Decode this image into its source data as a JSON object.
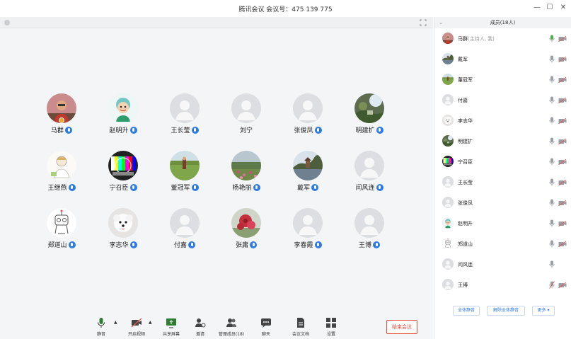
{
  "window": {
    "title": "腾讯会议 会议号：475 139 775",
    "minimize": "—",
    "maximize": "☐",
    "close": "✕"
  },
  "tiles": [
    {
      "name": "马群",
      "avatar": "photo-man",
      "host": true
    },
    {
      "name": "赵明升",
      "avatar": "cartoon"
    },
    {
      "name": "王长莹",
      "avatar": "default"
    },
    {
      "name": "刘宁",
      "avatar": "default",
      "no_mic": true
    },
    {
      "name": "张俊凤",
      "avatar": "default"
    },
    {
      "name": "明建扩",
      "avatar": "photo-garden"
    },
    {
      "name": "王继燕",
      "avatar": "sketch-girl"
    },
    {
      "name": "宁召臣",
      "avatar": "test-pattern"
    },
    {
      "name": "董冠军",
      "avatar": "photo-field"
    },
    {
      "name": "杨艳丽",
      "avatar": "photo-flowers"
    },
    {
      "name": "戴军",
      "avatar": "photo-lake"
    },
    {
      "name": "闫风连",
      "avatar": "default"
    },
    {
      "name": "郑道山",
      "avatar": "sketch-robot"
    },
    {
      "name": "李志华",
      "avatar": "dog"
    },
    {
      "name": "付嘉",
      "avatar": "default"
    },
    {
      "name": "张庸",
      "avatar": "photo-red-flower"
    },
    {
      "name": "李春霞",
      "avatar": "default"
    },
    {
      "name": "王博",
      "avatar": "default"
    }
  ],
  "toolbar": {
    "mute": "静音",
    "video": "开启视频",
    "share": "共享屏幕",
    "invite": "邀请",
    "members": "管理成员(18)",
    "chat": "聊天",
    "docs": "会议文档",
    "settings": "设置",
    "end": "结束会议"
  },
  "panel": {
    "title": "成员(18人)",
    "members": [
      {
        "name": "马群",
        "note": "(主持人, 我)",
        "avatar": "photo-man",
        "mic": "active"
      },
      {
        "name": "戴军",
        "avatar": "photo-lake",
        "mic": "muted"
      },
      {
        "name": "董冠军",
        "avatar": "photo-field",
        "mic": "muted"
      },
      {
        "name": "付嘉",
        "avatar": "default",
        "mic": "muted"
      },
      {
        "name": "李志华",
        "avatar": "dog",
        "mic": "muted"
      },
      {
        "name": "明建扩",
        "avatar": "photo-garden",
        "mic": "muted"
      },
      {
        "name": "宁召臣",
        "avatar": "test-pattern",
        "mic": "muted"
      },
      {
        "name": "王长莹",
        "avatar": "default",
        "mic": "muted"
      },
      {
        "name": "张俊凤",
        "avatar": "default",
        "mic": "muted"
      },
      {
        "name": "赵明升",
        "avatar": "cartoon",
        "mic": "muted"
      },
      {
        "name": "郑道山",
        "avatar": "sketch-robot",
        "mic": "muted"
      },
      {
        "name": "闫风连",
        "avatar": "default",
        "mic": "muted",
        "no_cam": true
      },
      {
        "name": "王博",
        "avatar": "default",
        "mic": "off"
      }
    ],
    "mute_all": "全体静音",
    "unmute_all": "解除全体静音",
    "more": "更多 ▾"
  },
  "colors": {
    "accent": "#2c7be5",
    "end": "#e74c3c",
    "mic_active": "#4caf50",
    "cam_off": "#e05a5a"
  }
}
